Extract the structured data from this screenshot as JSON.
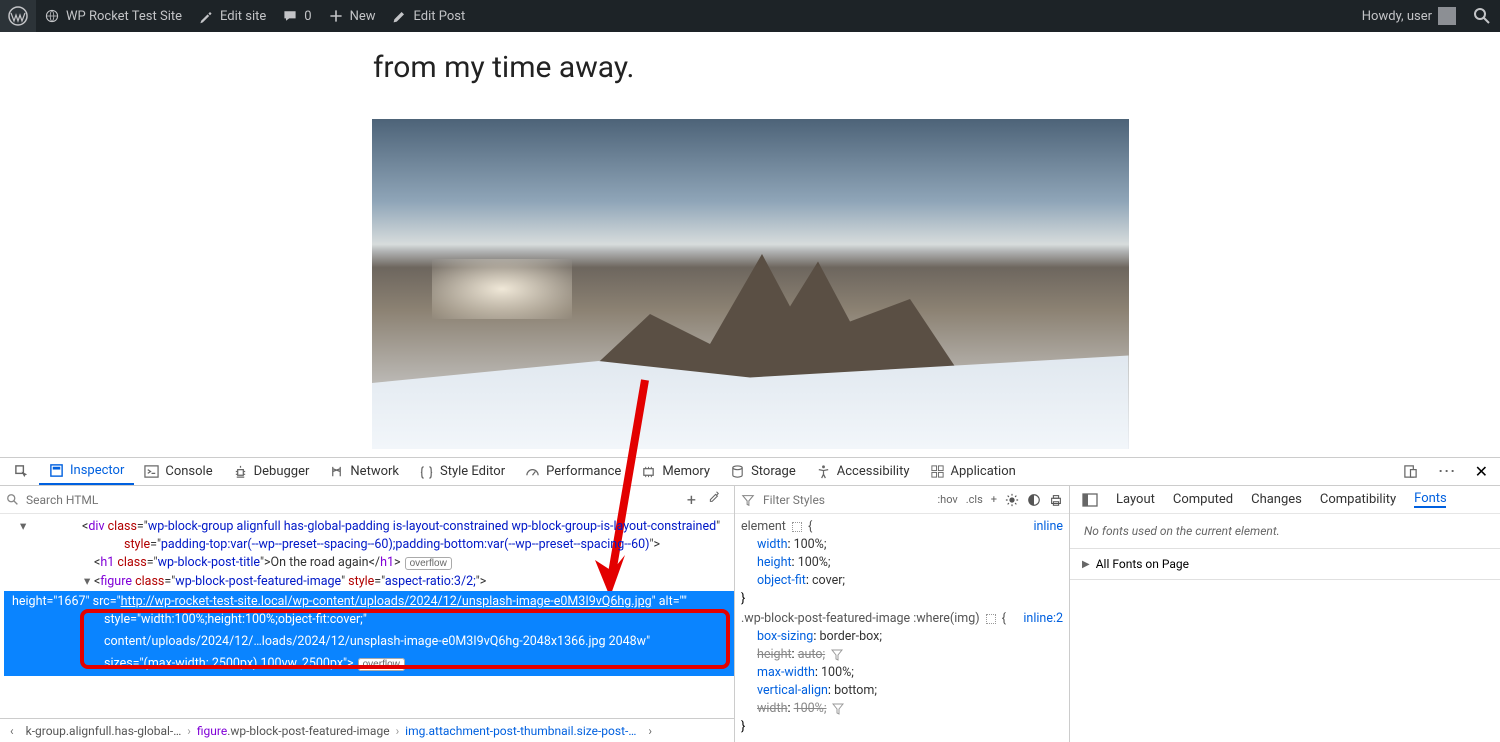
{
  "adminbar": {
    "site_title": "WP Rocket Test Site",
    "edit_site": "Edit site",
    "comments": "0",
    "new": "New",
    "edit_post": "Edit Post",
    "howdy": "Howdy, user"
  },
  "page": {
    "title_line": "from my time away."
  },
  "devtools": {
    "tabs": [
      "Inspector",
      "Console",
      "Debugger",
      "Network",
      "Style Editor",
      "Performance",
      "Memory",
      "Storage",
      "Accessibility",
      "Application"
    ],
    "active_tab": "Inspector",
    "search_placeholder": "Search HTML",
    "add_tooltip": "+",
    "tree": {
      "row1_pre": "<div ",
      "row1_class": "wp-block-group alignfull has-global-padding is-layout-constrained wp-block-group-is-layout-constrained",
      "row1_style": "padding-top:var(--wp--preset--spacing--60);padding-bottom:var(--wp--preset--spacing--60)",
      "row2_h1_open": "<h1 ",
      "row2_h1_class": "wp-block-post-title",
      "row2_text": "On the road again",
      "row2_close": "</h1>",
      "row2_overflow": "overflow",
      "row3_open": "<figure ",
      "row3_class": "wp-block-post-featured-image",
      "row3_style": "aspect-ratio:3/2;",
      "sel_line1": "height=\"1667\" src=\"",
      "sel_url1": "http://wp-rocket-test-site.local/wp-content/uploads/2024/12/unsplash-image-e0M3I9vQ6hg.jpg",
      "sel_line2": "\" alt=\"\" style=\"width:100%;height:100%;object-fit:cover;\"",
      "sel_line3": "content/uploads/2024/12/…loads/2024/12/unsplash-image-e0M3I9vQ6hg-2048x1366.jpg 2048w\"",
      "sel_line4": "sizes=\"(max-width: 2500px) 100vw, 2500px\">",
      "sel_overflow": "overflow"
    },
    "breadcrumb": {
      "seg1": "k-group.alignfull.has-global-…",
      "seg2a": "figure",
      "seg2b": ".wp-block-post-featured-image",
      "seg3": "img.attachment-post-thumbnail.size-post-…"
    },
    "styles": {
      "filter_placeholder": "Filter Styles",
      "hov": ":hov",
      "cls": ".cls",
      "plus": "+",
      "element_label": "element",
      "inline_src": "inline",
      "rule1": {
        "p1n": "width",
        "p1v": "100%;",
        "p2n": "height",
        "p2v": "100%;",
        "p3n": "object-fit",
        "p3v": "cover;"
      },
      "rule2_sel": ".wp-block-post-featured-image :where(img)",
      "rule2_src": "inline:2",
      "rule2": {
        "p1n": "box-sizing",
        "p1v": "border-box;",
        "p2n": "height",
        "p2v": "auto;",
        "p3n": "max-width",
        "p3v": "100%;",
        "p4n": "vertical-align",
        "p4v": "bottom;",
        "p5n": "width",
        "p5v": "100%;"
      }
    },
    "side": {
      "tabs": [
        "Layout",
        "Computed",
        "Changes",
        "Compatibility",
        "Fonts"
      ],
      "active": "Fonts",
      "msg": "No fonts used on the current element.",
      "row1": "All Fonts on Page"
    }
  }
}
